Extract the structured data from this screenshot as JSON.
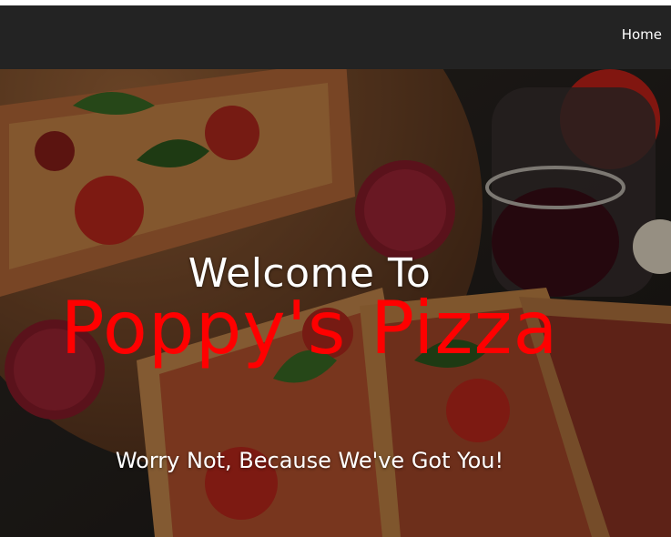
{
  "nav": {
    "home_label": "Home"
  },
  "hero": {
    "welcome": "Welcome To",
    "brand": "Poppy's Pizza",
    "tagline": "Worry Not, Because We've Got You!"
  },
  "colors": {
    "nav_background": "#232323",
    "brand_text": "#ff0000",
    "hero_text": "#ffffff"
  }
}
